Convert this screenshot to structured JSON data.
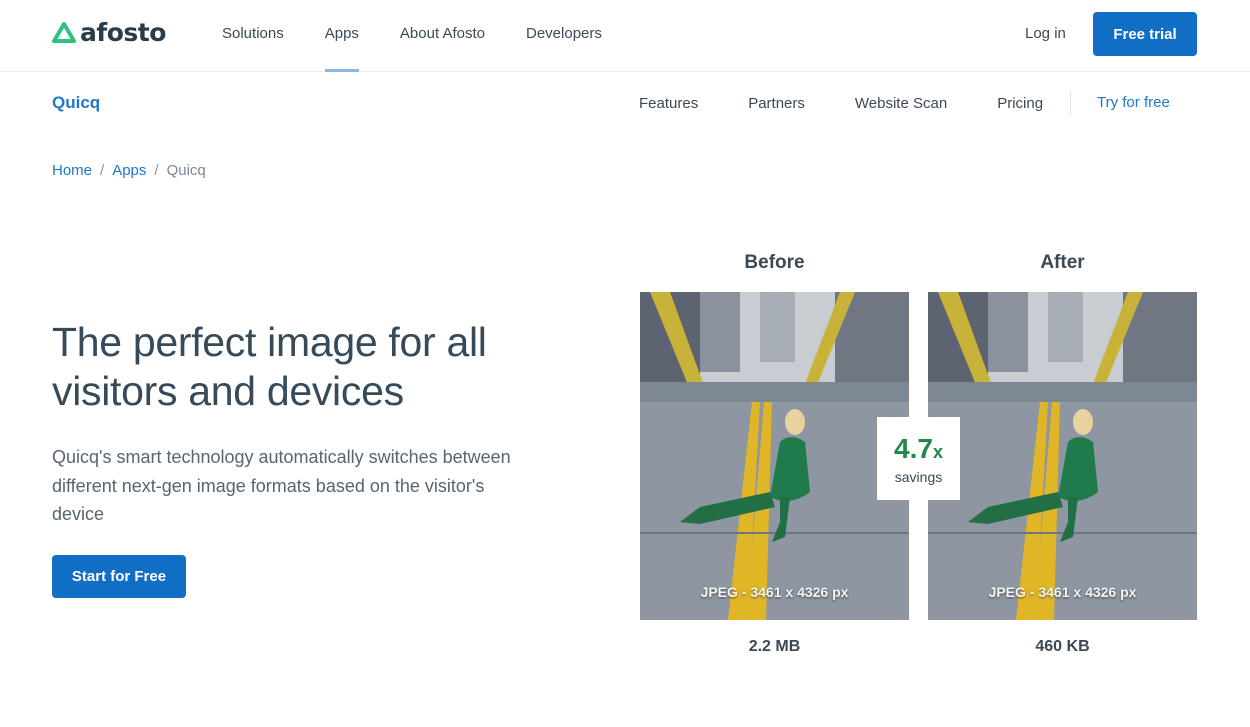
{
  "header": {
    "logo_text": "afosto",
    "nav": [
      "Solutions",
      "Apps",
      "About Afosto",
      "Developers"
    ],
    "active_nav": "Apps",
    "login_label": "Log in",
    "trial_label": "Free trial"
  },
  "subnav": {
    "product": "Quicq",
    "links": [
      "Features",
      "Partners",
      "Website Scan",
      "Pricing"
    ],
    "cta": "Try for free"
  },
  "breadcrumb": {
    "items": [
      "Home",
      "Apps"
    ],
    "current": "Quicq",
    "separator": "/"
  },
  "hero": {
    "title": "The perfect image for all visitors and devices",
    "description": "Quicq's smart technology automatically switches between different next-gen image formats based on the visitor's device",
    "cta": "Start for Free"
  },
  "comparison": {
    "before": {
      "label": "Before",
      "caption": "JPEG - 3461 x 4326 px",
      "size": "2.2 MB"
    },
    "after": {
      "label": "After",
      "caption": "JPEG - 3461 x 4326 px",
      "size": "460 KB"
    },
    "savings_value": "4.7",
    "savings_unit": "x",
    "savings_label": "savings"
  },
  "colors": {
    "brand_blue": "#106ec4",
    "link_blue": "#1f78c8",
    "logo_green": "#2ec27e",
    "savings_green": "#1e8a4a",
    "text_dark": "#364a5a"
  }
}
